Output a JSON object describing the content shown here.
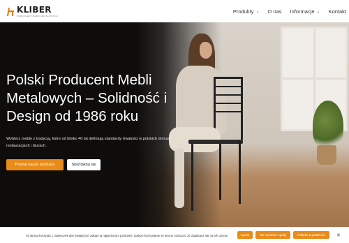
{
  "brand": {
    "name": "KLIBER",
    "tagline": "PRODUCENT MEBLI METALOWYCH",
    "accent_color": "#e98b18"
  },
  "nav": {
    "items": [
      {
        "label": "Produkty",
        "dropdown": true
      },
      {
        "label": "O nas",
        "dropdown": false
      },
      {
        "label": "Informacje",
        "dropdown": true
      },
      {
        "label": "Kontakt",
        "dropdown": false
      }
    ],
    "chevron_icon": "chevron-down-icon"
  },
  "hero": {
    "title": "Polski Producent Mebli Metalowych – Solidność i Design od 1986 roku",
    "subtitle": "Wybierz meble z tradycją, które od blisko 40 lat definiują standardy trwałości w polskich domach, restauracjach i biurach.",
    "primary_button": "Poznaj nasze produkty",
    "secondary_button": "Skontaktuj się"
  },
  "cookie_bar": {
    "text": "Ta strona korzysta z ciasteczek aby świadczyć usługi na najwyższym poziomie. Dalsze korzystanie ze strony oznacza, że zgadzasz się na ich użycie.",
    "accept": "Zgoda",
    "reject": "Nie wyrażam zgody",
    "policy": "Polityka prywatności",
    "close_icon": "close-icon"
  }
}
